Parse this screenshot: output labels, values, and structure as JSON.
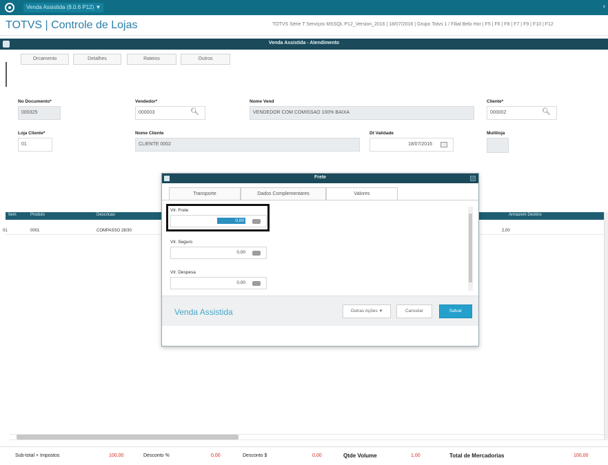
{
  "topbar": {
    "tab": "Venda Assistida (8.0.6 P12) ▼",
    "right_icon": "›"
  },
  "app": {
    "title": "TOTVS | Controle de Lojas",
    "info": "TOTVS Série T Serviços MSSQL P12_Version_2016  |  18/07/2016  |  Grupo Totvs 1 / Filial Belo Hor  |  F5 | F6 | F8 | F7 | F9 | F10 | F12"
  },
  "window": {
    "title": "Venda Assistida - Atendimento"
  },
  "toolbar": [
    "Orcamento",
    "Detalhes",
    "Rateios",
    "Outros"
  ],
  "form": {
    "doc_label": "No Documento*",
    "doc_value": "000325",
    "seller_label": "Vendedor*",
    "seller_value": "000003",
    "seller_name_label": "Nome Vend",
    "seller_name_value": "VENDEDOR COM COMISSAO 100% BAIXA",
    "client_label": "Cliente*",
    "client_value": "000002",
    "store_label": "Loja Cliente*",
    "store_value": "01",
    "client_name_label": "Nome Cliente",
    "client_name_value": "CLIENTE 0002",
    "validity_label": "Dt Validade",
    "validity_value": "18/07/2016",
    "multi_label": "Multiloja",
    "multi_value": ""
  },
  "grid": {
    "columns": [
      "Item",
      "Produto",
      "Descricao",
      "",
      "Armazem Destino"
    ],
    "row": [
      "01",
      "0001",
      "COMPASSO 28/30",
      "",
      "2,00"
    ]
  },
  "footer": {
    "subtotal_label": "Sub-total + Impostos",
    "subtotal_value": "100,00",
    "discount_pct_label": "Desconto %",
    "discount_pct_value": "0,00",
    "discount_val_label": "Desconto $",
    "discount_val_value": "0,00",
    "qty_label": "Qtde Volume",
    "qty_value": "1,00",
    "total_label": "Total de Mercadorias",
    "total_value": "100,00"
  },
  "modal": {
    "title": "Frete",
    "tabs": [
      "Transporte",
      "Dados Complementares",
      "Valores"
    ],
    "frete_label": "Vlr. Frete",
    "frete_value": "0,00",
    "seguro_label": "Vlr. Seguro",
    "seguro_value": "0,00",
    "despesa_label": "Vlr. Despesa",
    "despesa_value": "0,00",
    "brand": "Venda Assistida",
    "btn_other": "Outras Ações",
    "btn_cancel": "Cancelar",
    "btn_save": "Salvar"
  },
  "colors": {
    "accent": "#25a0cc",
    "header": "#0f6d86",
    "footer_value": "#d9261c"
  },
  "icons": {
    "search": "search-icon",
    "calculator": "calculator-icon",
    "calendar": "calendar-icon"
  }
}
